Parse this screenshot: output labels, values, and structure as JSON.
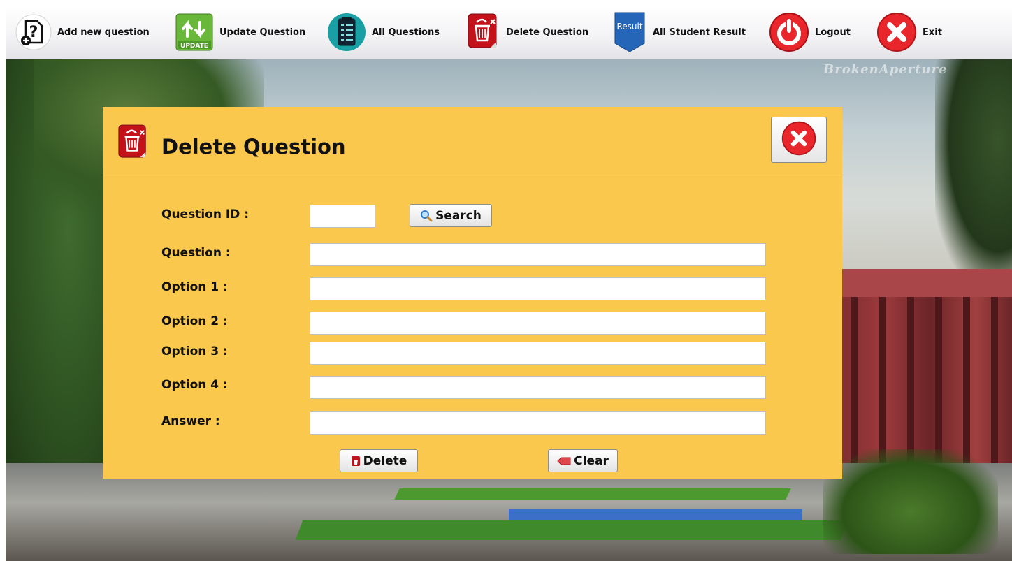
{
  "toolbar": {
    "items": [
      {
        "label": "Add new question",
        "icon": "add-question-icon"
      },
      {
        "label": "Update Question",
        "icon": "update-icon",
        "icon_text": "UPDATE"
      },
      {
        "label": "All Questions",
        "icon": "question-list-icon"
      },
      {
        "label": "Delete Question",
        "icon": "delete-trash-icon"
      },
      {
        "label": "All Student Result",
        "icon": "result-ribbon-icon",
        "icon_text": "Result"
      },
      {
        "label": "Logout",
        "icon": "power-icon"
      },
      {
        "label": "Exit",
        "icon": "exit-x-icon"
      }
    ]
  },
  "background": {
    "watermark": "BrokenAperture"
  },
  "dialog": {
    "title": "Delete Question",
    "icon": "delete-trash-icon",
    "close_icon": "close-x-icon",
    "fields": {
      "question_id": {
        "label": "Question ID :",
        "value": ""
      },
      "question": {
        "label": "Question :",
        "value": ""
      },
      "option1": {
        "label": "Option 1 :",
        "value": ""
      },
      "option2": {
        "label": "Option 2 :",
        "value": ""
      },
      "option3": {
        "label": "Option 3 :",
        "value": ""
      },
      "option4": {
        "label": "Option 4 :",
        "value": ""
      },
      "answer": {
        "label": "Answer :",
        "value": ""
      }
    },
    "search_label": "Search",
    "delete_label": "Delete",
    "clear_label": "Clear"
  },
  "colors": {
    "panel": "#f9c84d",
    "accent_red": "#e8262b",
    "toolbar_bg": "#f2f2f4"
  }
}
